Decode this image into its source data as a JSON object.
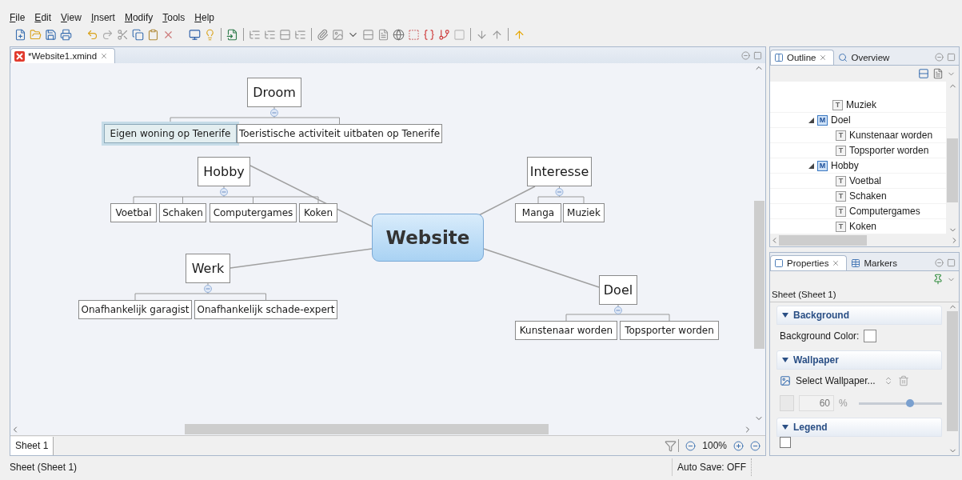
{
  "menu": [
    "File",
    "Edit",
    "View",
    "Insert",
    "Modify",
    "Tools",
    "Help"
  ],
  "editor": {
    "tab": {
      "title": "*Website1.xmind",
      "selected": true
    },
    "map": {
      "central": {
        "label": "Website",
        "selected": false
      },
      "topics": [
        {
          "label": "Droom",
          "selected": false,
          "children": [
            {
              "label": "Eigen woning op Tenerife",
              "selected": true
            },
            {
              "label": "Toeristische activiteit uitbaten op Tenerife",
              "selected": false
            }
          ]
        },
        {
          "label": "Hobby",
          "selected": false,
          "children": [
            {
              "label": "Voetbal",
              "selected": false
            },
            {
              "label": "Schaken",
              "selected": false
            },
            {
              "label": "Computergames",
              "selected": false
            },
            {
              "label": "Koken",
              "selected": false
            }
          ]
        },
        {
          "label": "Werk",
          "selected": false,
          "children": [
            {
              "label": "Onafhankelijk garagist",
              "selected": false
            },
            {
              "label": "Onafhankelijk schade-expert",
              "selected": false
            }
          ]
        },
        {
          "label": "Interesse",
          "selected": false,
          "children": [
            {
              "label": "Manga",
              "selected": false
            },
            {
              "label": "Muziek",
              "selected": false
            }
          ]
        },
        {
          "label": "Doel",
          "selected": false,
          "children": [
            {
              "label": "Kunstenaar worden",
              "selected": false
            },
            {
              "label": "Topsporter worden",
              "selected": false
            }
          ]
        }
      ]
    },
    "sheet_tab": {
      "label": "Sheet 1",
      "selected": true
    },
    "zoom": "100%"
  },
  "outline": {
    "tabs": [
      {
        "label": "Outline",
        "selected": true
      },
      {
        "label": "Overview",
        "selected": false
      }
    ],
    "items": [
      {
        "kind": "leaf",
        "badge": "T",
        "label": "Muziek"
      },
      {
        "kind": "branch",
        "badge": "M",
        "label": "Doel",
        "expanded": true,
        "children": [
          {
            "kind": "leaf",
            "badge": "T",
            "label": "Kunstenaar worden"
          },
          {
            "kind": "leaf",
            "badge": "T",
            "label": "Topsporter worden"
          }
        ]
      },
      {
        "kind": "branch",
        "badge": "M",
        "label": "Hobby",
        "expanded": true,
        "children": [
          {
            "kind": "leaf",
            "badge": "T",
            "label": "Voetbal"
          },
          {
            "kind": "leaf",
            "badge": "T",
            "label": "Schaken"
          },
          {
            "kind": "leaf",
            "badge": "T",
            "label": "Computergames"
          },
          {
            "kind": "leaf",
            "badge": "T",
            "label": "Koken"
          }
        ]
      }
    ]
  },
  "properties": {
    "tabs": [
      {
        "label": "Properties",
        "selected": true
      },
      {
        "label": "Markers",
        "selected": false
      }
    ],
    "title": "Sheet (Sheet 1)",
    "sections": [
      {
        "kind": "color",
        "title": "Background",
        "expanded": true,
        "label": "Background Color:"
      },
      {
        "kind": "wallpaper",
        "title": "Wallpaper",
        "expanded": true,
        "button": "Select Wallpaper...",
        "opacity_checked": false,
        "opacity": "60",
        "unit": "%",
        "level": 0.62
      },
      {
        "kind": "legend",
        "title": "Legend",
        "expanded": true,
        "checked": false
      }
    ]
  },
  "status_bar": {
    "text": "Sheet (Sheet 1)",
    "autosave": "Auto Save: OFF"
  }
}
